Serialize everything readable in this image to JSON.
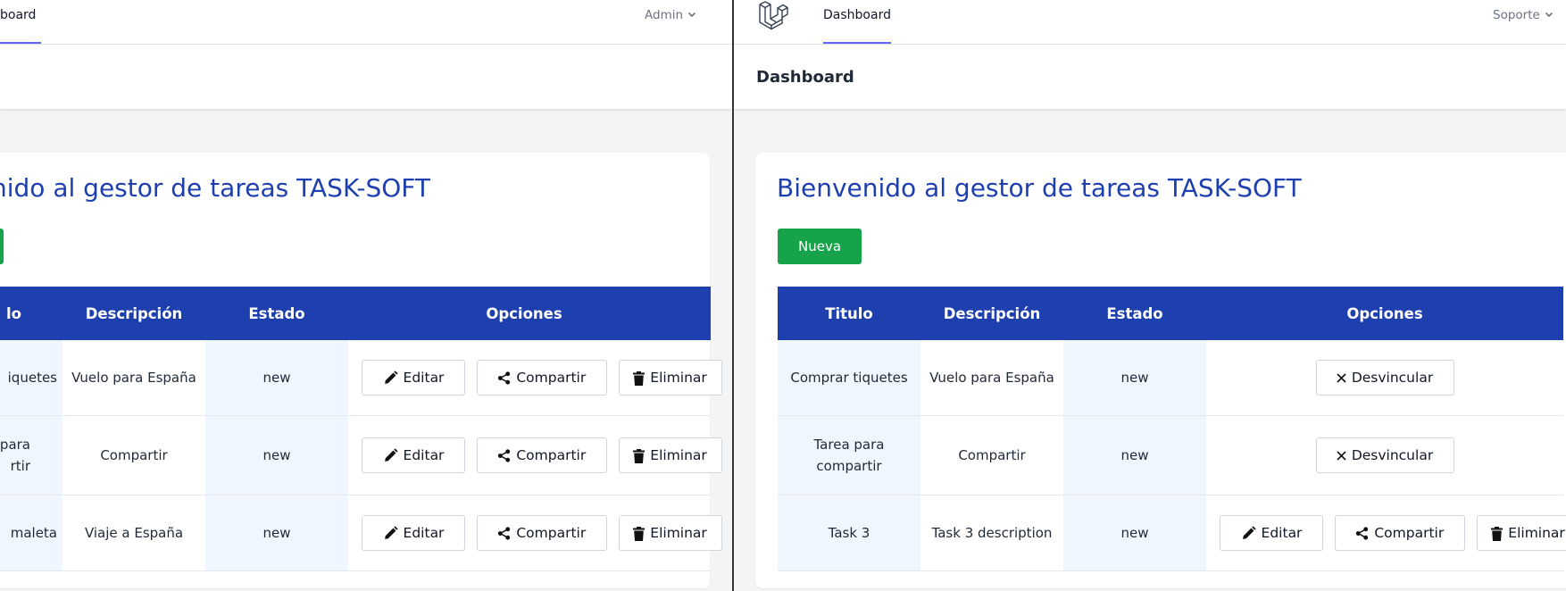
{
  "left": {
    "nav": {
      "link_label": "board",
      "user": "Admin"
    },
    "header": {
      "title": ""
    },
    "welcome": "nido al gestor de tareas TASK-SOFT",
    "table": {
      "headers": [
        "lo",
        "Descripción",
        "Estado",
        "Opciones"
      ],
      "rows": [
        {
          "title": "iquetes",
          "description": "Vuelo para España",
          "status": "new"
        },
        {
          "title": "para\nrtir",
          "description": "Compartir",
          "status": "new"
        },
        {
          "title": "maleta",
          "description": "Viaje a España",
          "status": "new"
        }
      ]
    }
  },
  "right": {
    "nav": {
      "link_label": "Dashboard",
      "user": "Soporte"
    },
    "header": {
      "title": "Dashboard"
    },
    "welcome": "Bienvenido al gestor de tareas TASK-SOFT",
    "new_button": "Nueva",
    "table": {
      "headers": [
        "Titulo",
        "Descripción",
        "Estado",
        "Opciones"
      ],
      "rows": [
        {
          "title": "Comprar tiquetes",
          "description": "Vuelo para España",
          "status": "new"
        },
        {
          "title": "Tarea para compartir",
          "description": "Compartir",
          "status": "new"
        },
        {
          "title": "Task 3",
          "description": "Task 3 description",
          "status": "new"
        }
      ]
    }
  },
  "actions": {
    "edit": "Editar",
    "share": "Compartir",
    "delete": "Eliminar",
    "unlink": "Desvincular"
  },
  "icons": {
    "edit": "pencil-icon",
    "share": "share-icon",
    "delete": "trash-icon",
    "unlink": "close-icon",
    "user_menu": "chevron-down-icon",
    "logo": "laravel-logo-icon"
  },
  "colors": {
    "accent": "#1e40af",
    "new_button": "#16a34a",
    "nav_underline": "#6366f1",
    "alt_cell": "#eff6ff"
  }
}
